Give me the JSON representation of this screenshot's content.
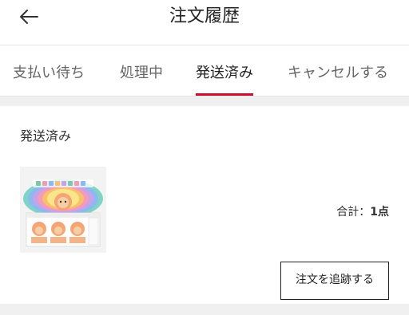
{
  "header": {
    "title": "注文履歴"
  },
  "tabs": [
    {
      "label": "支払い待ち"
    },
    {
      "label": "処理中"
    },
    {
      "label": "発送済み"
    },
    {
      "label": "キャンセルする"
    }
  ],
  "active_tab": 2,
  "order": {
    "status": "発送済み",
    "total_label": "合計：",
    "total_count": "1点",
    "track_button": "注文を追跡する"
  },
  "colors": {
    "accent": "#c8102e",
    "spacer": "#f0f0f0"
  },
  "icons": {
    "back": "arrow-left-icon"
  }
}
